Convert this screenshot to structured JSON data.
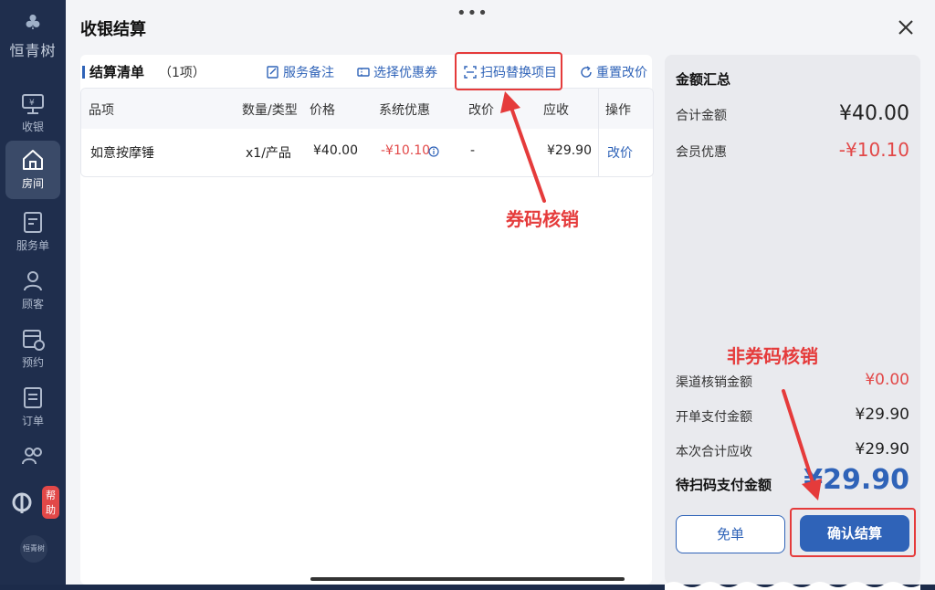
{
  "sidebar": {
    "brand_text": "恒青树",
    "items": [
      {
        "label": "收银",
        "icon": "cashier-monitor-icon",
        "active": false
      },
      {
        "label": "房间",
        "icon": "home-icon",
        "active": true
      },
      {
        "label": "服务单",
        "icon": "service-order-icon",
        "active": false
      },
      {
        "label": "顾客",
        "icon": "user-icon",
        "active": false
      },
      {
        "label": "预约",
        "icon": "calendar-clock-icon",
        "active": false
      },
      {
        "label": "订单",
        "icon": "order-list-icon",
        "active": false
      },
      {
        "label": "",
        "icon": "group-icon",
        "active": false
      }
    ],
    "help_badge": "帮助",
    "avatar_text": "恒青树"
  },
  "dialog": {
    "title": "收银结算",
    "section_title": "结算清单",
    "section_count": "（1项）",
    "actions": {
      "remark": "服务备注",
      "coupon": "选择优惠券",
      "scan_replace": "扫码替换项目",
      "reset_price": "重置改价"
    },
    "table": {
      "headers": [
        "品项",
        "数量/类型",
        "价格",
        "系统优惠",
        "改价",
        "应收",
        "操作"
      ],
      "rows": [
        {
          "item": "如意按摩锤",
          "qty": "x1/产品",
          "price": "¥40.00",
          "discount": "-¥10.10",
          "modified": "-",
          "receivable": "¥29.90",
          "action": "改价"
        }
      ]
    }
  },
  "summary": {
    "title": "金额汇总",
    "total_label": "合计金额",
    "total_value": "¥40.00",
    "member_label": "会员优惠",
    "member_value": "-¥10.10",
    "channel_label": "渠道核销金额",
    "channel_value": "¥0.00",
    "open_pay_label": "开单支付金额",
    "open_pay_value": "¥29.90",
    "current_label": "本次合计应收",
    "current_value": "¥29.90",
    "pending_label": "待扫码支付金额",
    "pending_value": "¥29.90",
    "free_button": "免单",
    "confirm_button": "确认结算"
  },
  "annotations": {
    "coupon_code": "券码核销",
    "non_coupon_code": "非券码核销"
  },
  "colors": {
    "accent": "#2f63b8",
    "red": "#e24848",
    "annotation": "#e53b3b",
    "sidebar": "#1f2e4d"
  }
}
